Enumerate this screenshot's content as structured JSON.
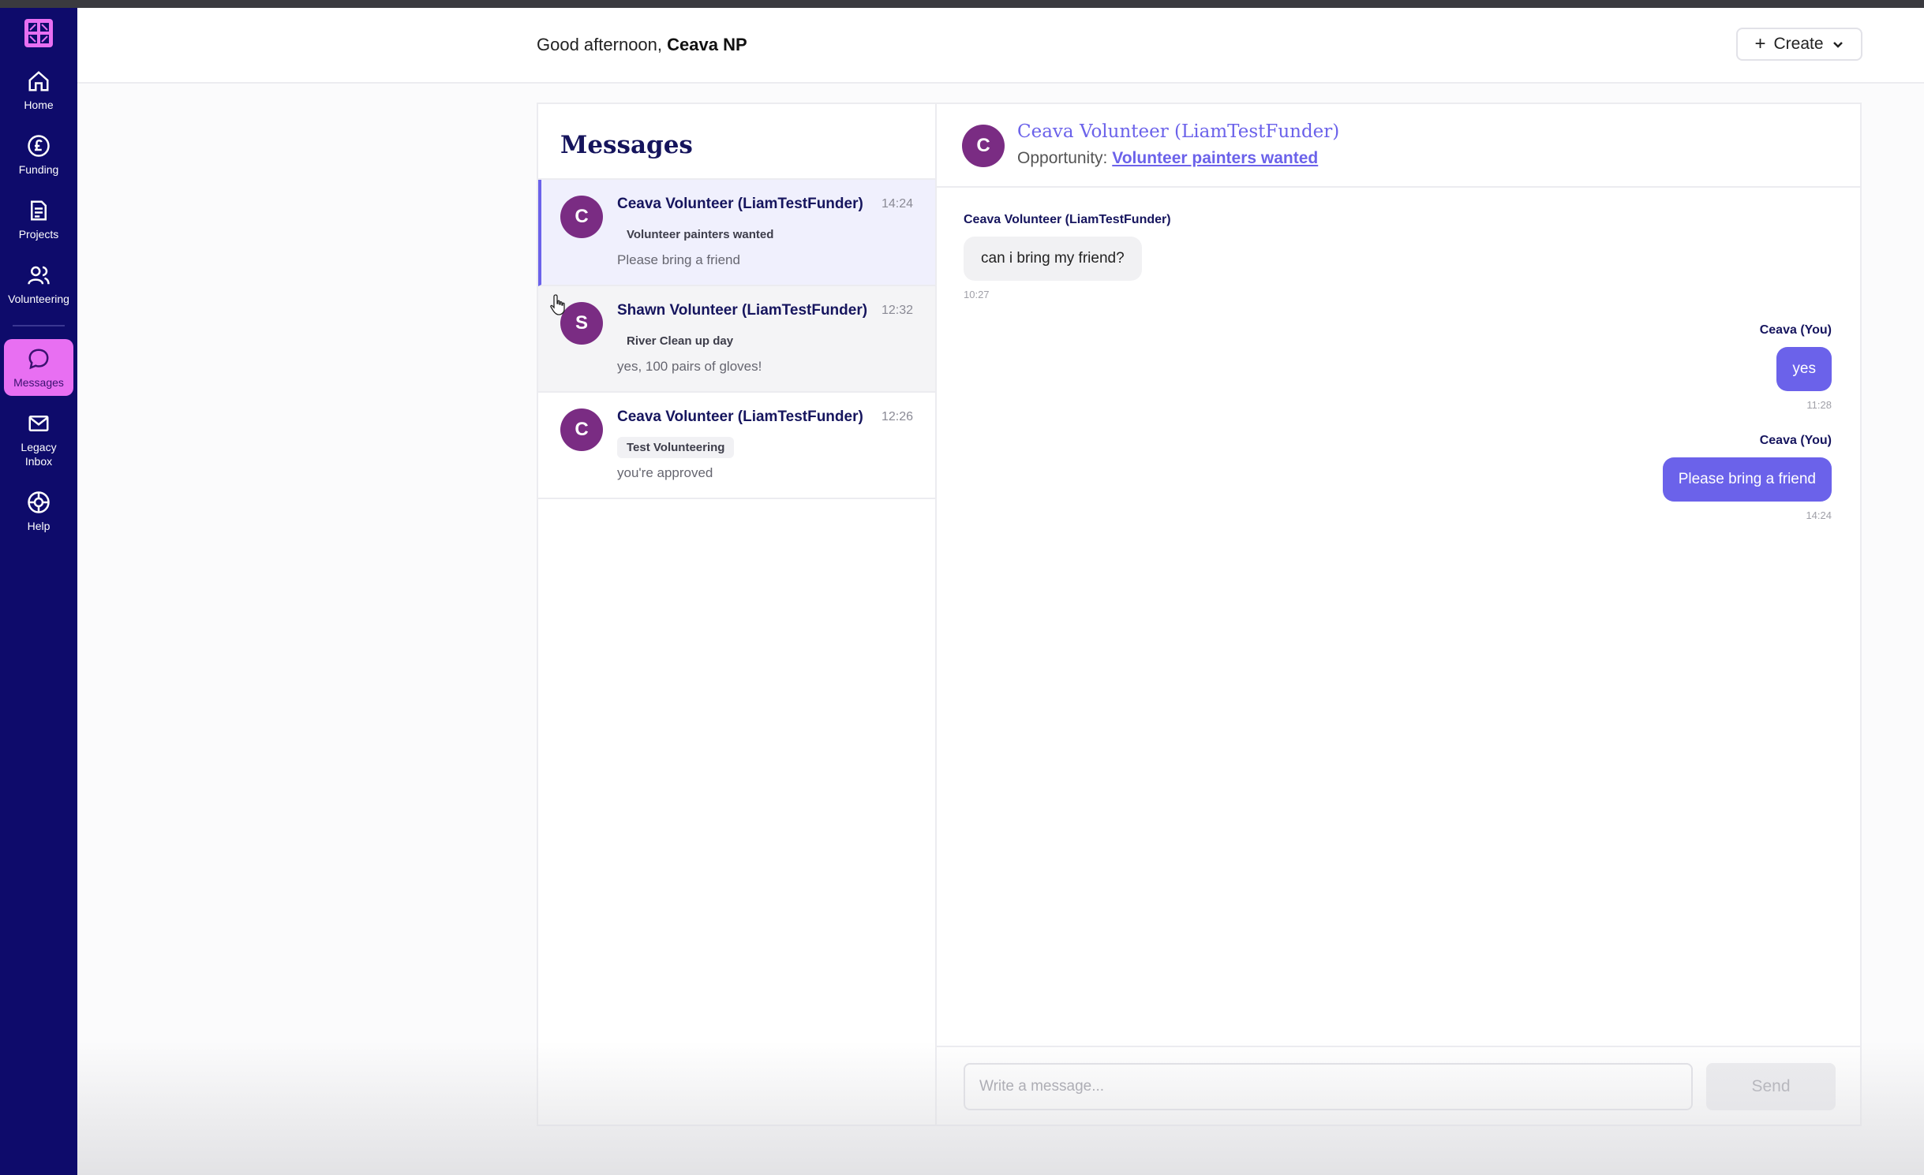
{
  "sidebar": {
    "logo_icon": "grid-logo-icon",
    "items": [
      {
        "label": "Home",
        "icon": "home-icon"
      },
      {
        "label": "Funding",
        "icon": "pound-icon"
      },
      {
        "label": "Projects",
        "icon": "document-icon"
      },
      {
        "label": "Volunteering",
        "icon": "people-icon"
      },
      {
        "label": "Messages",
        "icon": "chat-icon",
        "active": true
      },
      {
        "label": "Legacy Inbox",
        "icon": "mail-icon"
      },
      {
        "label": "Help",
        "icon": "lifebuoy-icon"
      }
    ]
  },
  "header": {
    "greeting_prefix": "Good afternoon,",
    "user_name": "Ceava NP",
    "create_label": "Create"
  },
  "messages_list": {
    "title": "Messages",
    "conversations": [
      {
        "initial": "C",
        "name": "Ceava Volunteer (LiamTestFunder)",
        "time": "14:24",
        "tag": "Volunteer painters wanted",
        "preview": "Please bring a friend",
        "selected": true
      },
      {
        "initial": "S",
        "name": "Shawn Volunteer (LiamTestFunder)",
        "time": "12:32",
        "tag": "River Clean up day",
        "preview": "yes, 100 pairs of gloves!"
      },
      {
        "initial": "C",
        "name": "Ceava Volunteer (LiamTestFunder)",
        "time": "12:26",
        "tag": "Test Volunteering",
        "preview": "you're approved"
      }
    ]
  },
  "chat": {
    "avatar_initial": "C",
    "contact_name": "Ceava Volunteer (LiamTestFunder)",
    "opportunity_label": "Opportunity:",
    "opportunity_link": "Volunteer painters wanted",
    "messages": [
      {
        "sender": "Ceava Volunteer (LiamTestFunder)",
        "text": "can i bring my friend?",
        "time": "10:27",
        "direction": "in"
      },
      {
        "sender": "Ceava (You)",
        "text": "yes",
        "time": "11:28",
        "direction": "out"
      },
      {
        "sender": "Ceava (You)",
        "text": "Please bring a friend",
        "time": "14:24",
        "direction": "out"
      }
    ],
    "composer_placeholder": "Write a message...",
    "send_label": "Send"
  },
  "colors": {
    "sidebar_bg": "#0e0b6b",
    "accent": "#6b62ea",
    "active_nav": "#e86ff2",
    "avatar_bg": "#7a2c83"
  }
}
